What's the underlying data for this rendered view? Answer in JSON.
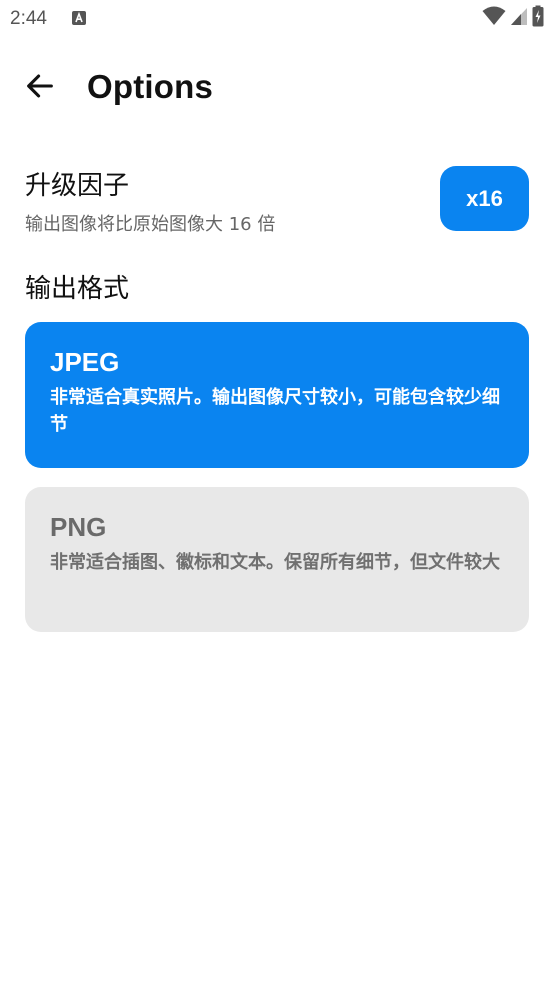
{
  "status_bar": {
    "time": "2:44",
    "notification_icon": "text-a-icon",
    "wifi_icon": "wifi-icon",
    "signal_icon": "cell-signal-icon",
    "battery_icon": "battery-charging-icon"
  },
  "header": {
    "back_icon": "arrow-left-icon",
    "title": "Options"
  },
  "scale": {
    "title": "升级因子",
    "description": "输出图像将比原始图像大 16 倍",
    "button_label": "x16"
  },
  "format": {
    "heading": "输出格式",
    "options": [
      {
        "title": "JPEG",
        "description": "非常适合真实照片。输出图像尺寸较小，可能包含较少细节",
        "selected": true
      },
      {
        "title": "PNG",
        "description": "非常适合插图、徽标和文本。保留所有细节，但文件较大",
        "selected": false
      }
    ]
  },
  "colors": {
    "accent": "#0A84F0",
    "unselected_card": "#E8E8E8",
    "secondary_text": "#666666"
  }
}
